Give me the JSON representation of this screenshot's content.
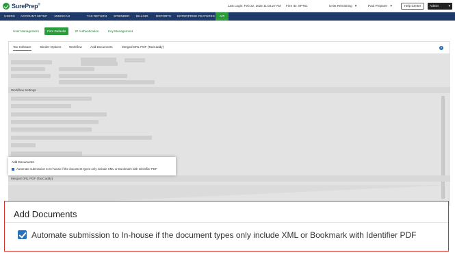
{
  "app": {
    "logo_text": "SurePrep",
    "logo_tm": "®"
  },
  "header": {
    "last_login": "Last Login: Feb 22, 2022 11:02:27 AM",
    "firm_id": "Firm ID:  SPT51",
    "units_remaining": "Units Remaining",
    "user_name": "Paul Preparer",
    "help_center": "Help Center",
    "admin": "Admin"
  },
  "nav": {
    "items": [
      "USERS",
      "ACCOUNT SETUP",
      "1040SCAN",
      "TAX RETURN",
      "SPBINDER",
      "BILLING",
      "REPORTS",
      "ENTERPRISE FEATURES",
      "API"
    ]
  },
  "subtabs": {
    "items": [
      "User Management",
      "Firm Defaults",
      "IP Authentication",
      "Key Management"
    ]
  },
  "panel_tabs": {
    "items": [
      "Tax Software",
      "Binder Options",
      "Workflow",
      "Add Documents",
      "Merged DRL PDF (TaxCaddy)"
    ]
  },
  "sections": {
    "workflow_settings": "Workflow Settings",
    "merged_drl": "Merged DRL PDF (TaxCaddy)"
  },
  "add_documents": {
    "title": "Add Documents",
    "checkbox_label": "Automate submission to In-house if the document types only include XML or Bookmark with Identifier PDF",
    "checked": true
  },
  "colors": {
    "nav_bg": "#1f3a68",
    "accent_green": "#2a9d3a",
    "checkbox_blue": "#2b6fb5",
    "callout_red": "#d6332f"
  }
}
